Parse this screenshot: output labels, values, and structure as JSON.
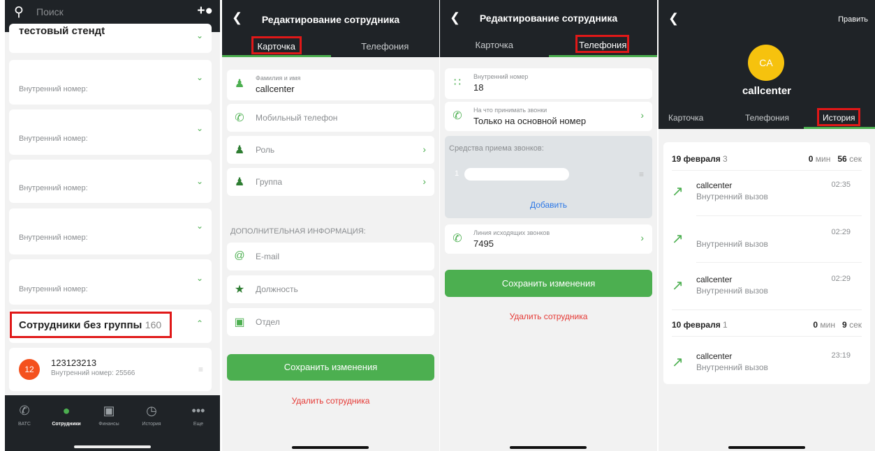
{
  "screen1": {
    "search_placeholder": "Поиск",
    "group_title": "тестовый стендt",
    "internal_label": "Внутренний номер:",
    "group2_title": "Сотрудники без группы",
    "group2_count": "160",
    "employee": {
      "avatar": "12",
      "name": "123123213",
      "number": "Внутренний номер: 25566"
    },
    "tabs": [
      {
        "label": "ВАТС",
        "icon": "phone-icon"
      },
      {
        "label": "Сотрудники",
        "icon": "user-icon"
      },
      {
        "label": "Финансы",
        "icon": "wallet-icon"
      },
      {
        "label": "История",
        "icon": "clock-icon"
      },
      {
        "label": "Еще",
        "icon": "more-icon"
      }
    ]
  },
  "screen2": {
    "title": "Редактирование сотрудника",
    "tab_card": "Карточка",
    "tab_phone": "Телефония",
    "fio_label": "Фамилия и имя",
    "fio_value": "callcenter",
    "mobile": "Мобильный телефон",
    "role": "Роль",
    "group": "Группа",
    "extra_header": "ДОПОЛНИТЕЛЬНАЯ ИНФОРМАЦИЯ:",
    "email": "E-mail",
    "position": "Должность",
    "department": "Отдел",
    "save": "Сохранить изменения",
    "delete": "Удалить сотрудника"
  },
  "screen3": {
    "title": "Редактирование сотрудника",
    "tab_card": "Карточка",
    "tab_phone": "Телефония",
    "ext_label": "Внутренний номер",
    "ext_value": "18",
    "accept_label": "На что принимать звонки",
    "accept_value": "Только на основной номер",
    "means_header": "Средства приема звонков:",
    "means_index": "1",
    "add": "Добавить",
    "line_label": "Линия исходящих звонков",
    "line_value": "7495",
    "save": "Сохранить изменения",
    "delete": "Удалить сотрудника"
  },
  "screen4": {
    "edit": "Править",
    "avatar": "CA",
    "name": "callcenter",
    "tabs": [
      "Карточка",
      "Телефония",
      "История"
    ],
    "days": [
      {
        "date": "19 февраля",
        "count": "3",
        "min": "0",
        "min_unit": "мин",
        "sec": "56",
        "sec_unit": "сек"
      },
      {
        "date": "10 февраля",
        "count": "1",
        "min": "0",
        "min_unit": "мин",
        "sec": "9",
        "sec_unit": "сек"
      }
    ],
    "calls": [
      {
        "name": "callcenter",
        "type": "Внутренний вызов",
        "time": "02:35"
      },
      {
        "name": "",
        "type": "Внутренний вызов",
        "time": "02:29"
      },
      {
        "name": "callcenter",
        "type": "Внутренний вызов",
        "time": "02:29"
      },
      {
        "name": "callcenter",
        "type": "Внутренний вызов",
        "time": "23:19"
      }
    ]
  },
  "colors": {
    "accent": "#4caf50",
    "header": "#1f2327",
    "highlight": "#e01818",
    "danger": "#e53935",
    "link": "#2b77e6"
  }
}
